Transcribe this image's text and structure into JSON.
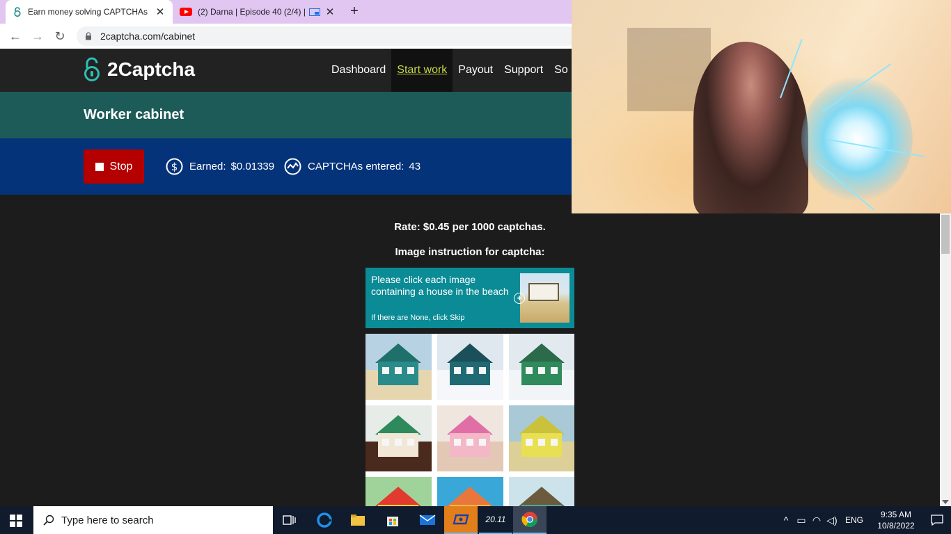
{
  "browser": {
    "tabs": [
      {
        "title": "Earn money solving CAPTCHAs",
        "active": true,
        "favicon": "2captcha-lock-icon"
      },
      {
        "title": "(2) Darna | Episode 40 (2/4) |",
        "active": false,
        "favicon": "youtube-icon",
        "pip": true
      }
    ],
    "url": "2captcha.com/cabinet"
  },
  "site": {
    "brand": "2Captcha",
    "nav": [
      "Dashboard",
      "Start work",
      "Payout",
      "Support",
      "So"
    ],
    "active_nav": "Start work",
    "cabinet_title": "Worker cabinet",
    "stop_label": "Stop",
    "earned_label": "Earned:",
    "earned_value": "$0.01339",
    "entered_label": "CAPTCHAs entered:",
    "entered_value": "43",
    "rate_text": "Rate: $0.45 per 1000 captchas.",
    "instruction_title": "Image instruction for captcha:",
    "instruction_main": "Please click each image containing a house in the beach",
    "instruction_sub": "If there are None, click Skip"
  },
  "captcha_tiles": [
    {
      "desc": "beach house teal",
      "sky": "#b7d3e3",
      "ground": "#e6d6b0",
      "roof": "#1f6f6a",
      "body": "#2a8c8a"
    },
    {
      "desc": "snowy house teal",
      "sky": "#dfe8ef",
      "ground": "#f5f7fa",
      "roof": "#1b4f5a",
      "body": "#1f6a73"
    },
    {
      "desc": "snowy house green",
      "sky": "#e2eaf0",
      "ground": "#f2f5f8",
      "roof": "#2b6a4a",
      "body": "#2f8a5c"
    },
    {
      "desc": "dollhouse green",
      "sky": "#e8ece8",
      "ground": "#4a2a1c",
      "roof": "#2e8a5c",
      "body": "#f0e7d6"
    },
    {
      "desc": "dollhouse pink",
      "sky": "#f0e6e0",
      "ground": "#e3c9b5",
      "roof": "#e06fa6",
      "body": "#f3b7c8"
    },
    {
      "desc": "beach house yellow",
      "sky": "#a9c9d6",
      "ground": "#ddcf98",
      "roof": "#c9c23a",
      "body": "#e8e052"
    },
    {
      "desc": "toy house red roof",
      "sky": "#9fd39a",
      "ground": "#6bbf5a",
      "roof": "#e23a2e",
      "body": "#f1d44a"
    },
    {
      "desc": "toy house orange",
      "sky": "#3aa7d9",
      "ground": "#4cb24a",
      "roof": "#e9773b",
      "body": "#f3b94a"
    },
    {
      "desc": "beach house green",
      "sky": "#cde3ec",
      "ground": "#e9ddb6",
      "roof": "#6c5a3d",
      "body": "#4fa890"
    }
  ],
  "taskbar": {
    "search_placeholder": "Type here to search",
    "apps": [
      "task-view-icon",
      "edge-icon",
      "file-explorer-icon",
      "store-icon",
      "mail-icon",
      "screen-recorder-icon",
      "timer-icon",
      "chrome-icon"
    ],
    "timer_label": "20.11",
    "tray_language": "ENG",
    "time": "9:35 AM",
    "date": "10/8/2022"
  },
  "colors": {
    "header_bg": "#222222",
    "cabinet_bg": "#1d5b58",
    "status_bg": "#05337a",
    "stop_bg": "#b40000",
    "instruction_bg": "#0b8b96",
    "active_nav": "#c6d84a"
  }
}
